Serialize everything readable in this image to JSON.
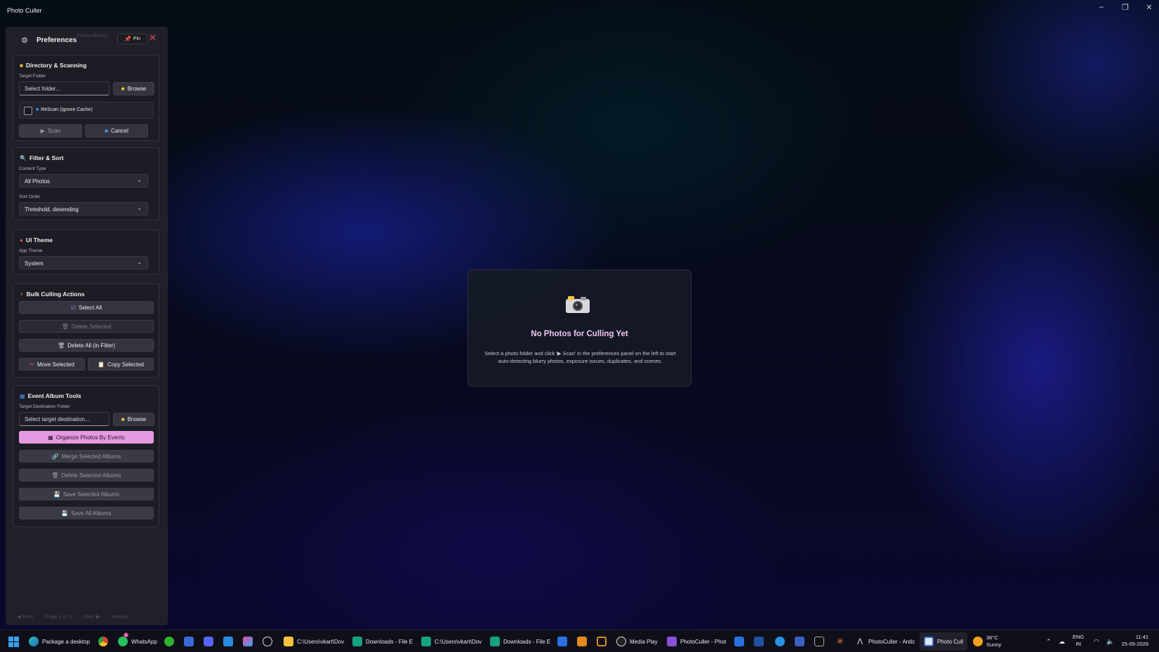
{
  "app": {
    "title": "Photo Culler"
  },
  "window_controls": {
    "minimize": "–",
    "restore": "❐",
    "close": "✕"
  },
  "preferences": {
    "title": "Preferences",
    "ghost_tab": "Photo Albums",
    "pin_label": "Pin",
    "close_glyph": "✕"
  },
  "directory": {
    "title": "Directory & Scanning",
    "target_label": "Target Folder",
    "target_value": "Select folder...",
    "browse_label": "Browse",
    "rescan_label": "ReScan (Ignore Cache)",
    "scan_label": "Scan",
    "cancel_label": "Cancel"
  },
  "filter": {
    "title": "Filter & Sort",
    "content_type_label": "Content Type",
    "content_type_value": "All Photos",
    "sort_label": "Sort Order",
    "sort_value": "Threshold, desending"
  },
  "theme": {
    "title": "UI Theme",
    "app_theme_label": "App Theme",
    "app_theme_value": "System"
  },
  "bulk": {
    "title": "Bulk Culling Actions",
    "select_all": "Select All",
    "delete_selected": "Delete Selected",
    "delete_all": "Delete All (in Filter)",
    "move_selected": "Move Selected",
    "copy_selected": "Copy Selected"
  },
  "albums": {
    "title": "Event Album Tools",
    "dest_label": "Target Destination Folder",
    "dest_value": "Select target destination...",
    "browse_label": "Browse",
    "organize": "Organize Photos By Events",
    "merge": "Merge Selected Albums",
    "delete": "Delete Selected Albums",
    "save_selected": "Save Selected Albums",
    "save_all": "Save All Albums"
  },
  "pager": {
    "prev": "◀ Prev",
    "page": "Page 1 of 1",
    "next": "Next ▶",
    "status": "Ready"
  },
  "empty_state": {
    "title": "No Photos for Culling Yet",
    "description": "Select a photo folder and click '▶ Scan' in the preferences panel on the left to start auto-detecting blurry photos, exposure issues, duplicates, and scenes."
  },
  "taskbar": {
    "items": [
      "Package a desktop",
      "WhatsApp",
      "C:\\Users\\vkart\\Dov",
      "Downloads - File E",
      "C:\\Users\\vkart\\Dov",
      "Downloads - File E",
      "Media Play",
      "PhotoCuller - Phot",
      "PhotoCuller - Antic",
      "Photo Cull"
    ],
    "whatsapp_badge": "1",
    "weather_temp": "36°C",
    "weather_desc": "Sunny",
    "lang_top": "ENG",
    "lang_bottom": "IN",
    "time": "11:41",
    "date": "25-05-2026"
  },
  "colors": {
    "accent_pink": "#e49ae0",
    "title_pink": "#efc6ef",
    "close_red": "#e04a5a"
  }
}
